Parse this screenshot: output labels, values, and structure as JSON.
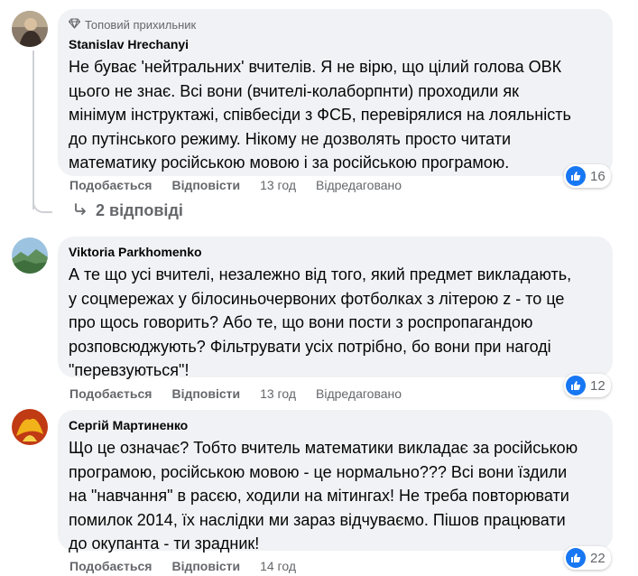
{
  "comments": [
    {
      "badge": "Топовий прихильник",
      "author": "Stanislav Hrechanyi",
      "text": "Не буває 'нейтральних' вчителів. Я не вірю, що цілий голова ОВК\nцього не знає. Всі вони (вчителі-колаборпнти) проходили як\nмінімум інструктажі, співбесіди з ФСБ, перевірялися на лояльність\nдо путінського режиму. Нікому не дозволять просто читати\nматематику російською мовою і за російською програмою.",
      "like_label": "Подобається",
      "reply_label": "Відповісти",
      "time": "13 год",
      "edited": "Відредаговано",
      "reactions": "16"
    },
    {
      "author": "Viktoria Parkhomenko",
      "text": "А те що усі вчителі, незалежно від того, який предмет викладають,\nу соцмережах у білосиньочервоних фотболках з літерою z - то це\nпро щось говорить? Або те, що вони пости з роспропагандою\nрозповсюджують? Фільтрувати усіх потрібно, бо вони при нагоді\n\"перевзуються\"!",
      "like_label": "Подобається",
      "reply_label": "Відповісти",
      "time": "13 год",
      "edited": "Відредаговано",
      "reactions": "12"
    },
    {
      "author": "Сергій Мартиненко",
      "text": "Що це означає? Тобто вчитель математики викладає за російською\nпрограмою, російською мовою - це нормально??? Всі вони їздили\nна \"навчання\" в расєю, ходили на мітингах! Не треба повторювати\nпомилок 2014, їх наслідки ми зараз відчуваємо. Пішов працювати\nдо окупанта - ти зрадник!",
      "like_label": "Подобається",
      "reply_label": "Відповісти",
      "time": "14 год",
      "reactions": "22"
    }
  ],
  "replies_link": "2 відповіді",
  "icons": {
    "badge": "diamond-icon",
    "reply_arrow": "reply-arrow-icon",
    "like": "like-icon"
  },
  "colors": {
    "like_blue": "#1877f2",
    "bubble_bg": "#f0f2f5",
    "meta_gray": "#65676b"
  }
}
